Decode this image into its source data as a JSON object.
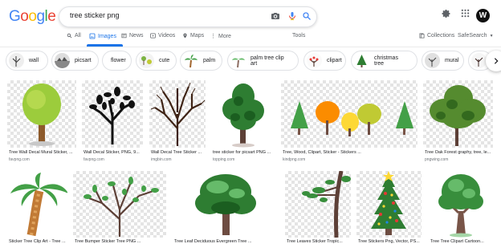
{
  "header": {
    "logo": [
      "G",
      "o",
      "o",
      "g",
      "l",
      "e"
    ],
    "logo_colors": [
      "#4285f4",
      "#ea4335",
      "#fbbc05",
      "#4285f4",
      "#34a853",
      "#ea4335"
    ],
    "query": "tree sticker png",
    "avatar_letter": "W"
  },
  "tabs": [
    {
      "label": "All",
      "icon": "search-icon"
    },
    {
      "label": "Images",
      "icon": "image-icon",
      "active": true
    },
    {
      "label": "News",
      "icon": "news-icon"
    },
    {
      "label": "Videos",
      "icon": "video-icon"
    },
    {
      "label": "Maps",
      "icon": "map-pin-icon"
    },
    {
      "label": "More",
      "icon": "more-vert-icon"
    }
  ],
  "tools_label": "Tools",
  "collections_label": "Collections",
  "safesearch_label": "SafeSearch",
  "chips": [
    "wall",
    "picsart",
    "flower",
    "cute",
    "palm",
    "palm tree clip art",
    "clipart",
    "christmas tree",
    "mural",
    ""
  ],
  "results_row1": [
    {
      "title": "Tree Wall Decal Mural Sticker, ...",
      "source": "favpng.com"
    },
    {
      "title": "Wall Decal Sticker, PNG, 9...",
      "source": "favpng.com"
    },
    {
      "title": "Wall Decal Tree Sticker ...",
      "source": "imgbin.com"
    },
    {
      "title": "tree sticker for picsart PNG ...",
      "source": "topping.com"
    },
    {
      "title": "Tree, Wood, Clipart, Sticker - Stickers ...",
      "source": "kindpng.com"
    },
    {
      "title": "Tree Oak Forest graphy, tree, le...",
      "source": "pngwing.com"
    }
  ],
  "results_row2": [
    {
      "title": "Sticker Tree Clip Art - Tree ...",
      "source": ""
    },
    {
      "title": "Tree Bumper Sticker Tree PNG ...",
      "source": ""
    },
    {
      "title": "Tree Leaf Deciduous Evergreen Tree ...",
      "source": ""
    },
    {
      "title": "Tree Leaves Sticker Tropic...",
      "source": ""
    },
    {
      "title": "Tree Stickers Png, Vector, PS...",
      "source": ""
    },
    {
      "title": "Tree Tree Clipart Cartoon...",
      "source": ""
    }
  ],
  "colors": {
    "accent": "#1a73e8",
    "chip_border": "#dfe1e5"
  }
}
